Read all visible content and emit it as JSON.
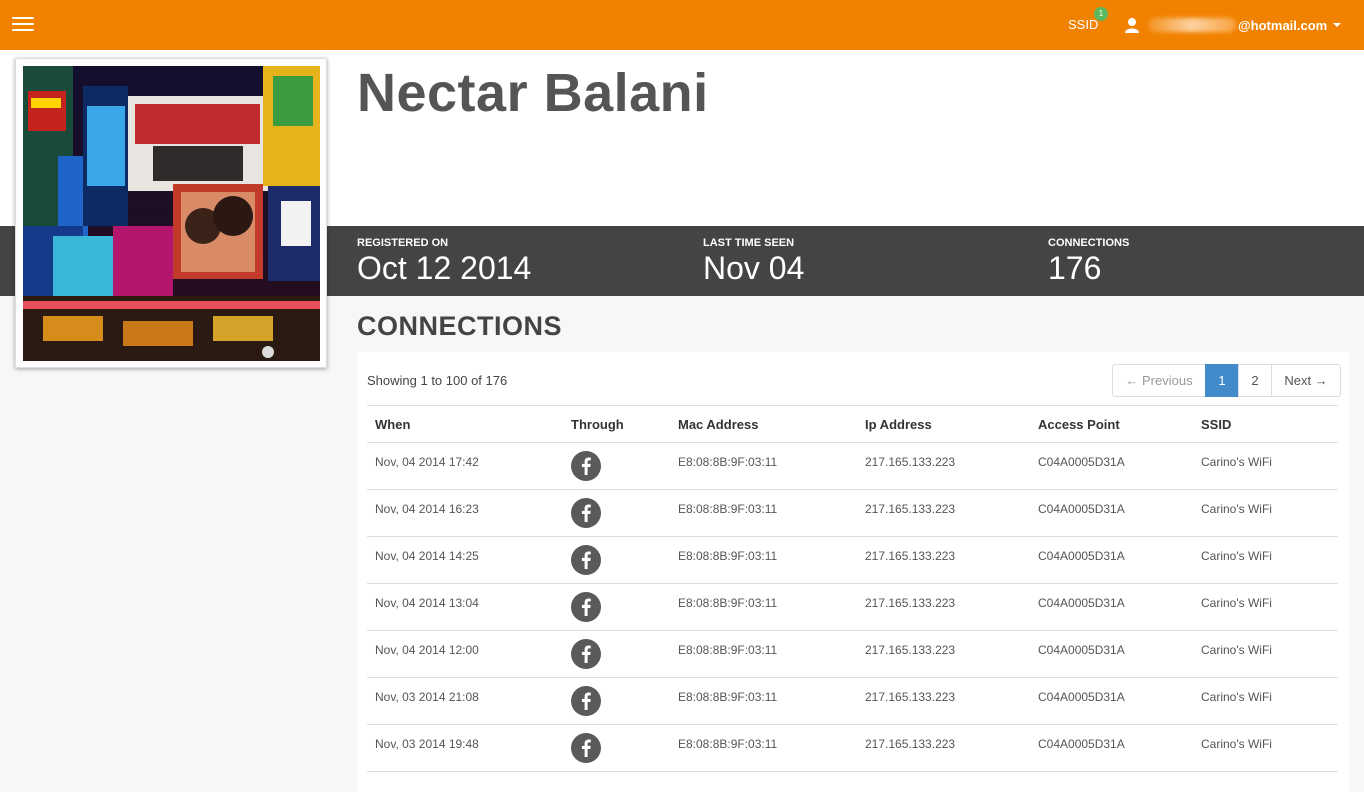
{
  "topbar": {
    "menu_icon": "hamburger-icon",
    "ssid_label": "SSID",
    "ssid_badge": "1",
    "user_icon": "user-icon",
    "user_email_suffix": "@hotmail.com",
    "brand_color": "#f18200"
  },
  "profile": {
    "name": "Nectar Balani",
    "photo_icon": "profile-photo"
  },
  "stats": {
    "registered_label": "REGISTERED ON",
    "registered_value": "Oct 12 2014",
    "last_seen_label": "LAST TIME SEEN",
    "last_seen_value": "Nov 04",
    "connections_label": "CONNECTIONS",
    "connections_value": "176"
  },
  "connections": {
    "title": "CONNECTIONS",
    "showing": "Showing 1 to 100 of 176",
    "pagination": {
      "previous": "← Previous",
      "pages": [
        "1",
        "2"
      ],
      "active_page": "1",
      "next": "Next →"
    },
    "columns": [
      "When",
      "Through",
      "Mac Address",
      "Ip Address",
      "Access Point",
      "SSID"
    ],
    "rows": [
      {
        "when": "Nov, 04 2014 17:42",
        "through": "facebook-icon",
        "mac": "E8:08:8B:9F:03:11",
        "ip": "217.165.133.223",
        "ap": "C04A0005D31A",
        "ssid": "Carino's WiFi"
      },
      {
        "when": "Nov, 04 2014 16:23",
        "through": "facebook-icon",
        "mac": "E8:08:8B:9F:03:11",
        "ip": "217.165.133.223",
        "ap": "C04A0005D31A",
        "ssid": "Carino's WiFi"
      },
      {
        "when": "Nov, 04 2014 14:25",
        "through": "facebook-icon",
        "mac": "E8:08:8B:9F:03:11",
        "ip": "217.165.133.223",
        "ap": "C04A0005D31A",
        "ssid": "Carino's WiFi"
      },
      {
        "when": "Nov, 04 2014 13:04",
        "through": "facebook-icon",
        "mac": "E8:08:8B:9F:03:11",
        "ip": "217.165.133.223",
        "ap": "C04A0005D31A",
        "ssid": "Carino's WiFi"
      },
      {
        "when": "Nov, 04 2014 12:00",
        "through": "facebook-icon",
        "mac": "E8:08:8B:9F:03:11",
        "ip": "217.165.133.223",
        "ap": "C04A0005D31A",
        "ssid": "Carino's WiFi"
      },
      {
        "when": "Nov, 03 2014 21:08",
        "through": "facebook-icon",
        "mac": "E8:08:8B:9F:03:11",
        "ip": "217.165.133.223",
        "ap": "C04A0005D31A",
        "ssid": "Carino's WiFi"
      },
      {
        "when": "Nov, 03 2014 19:48",
        "through": "facebook-icon",
        "mac": "E8:08:8B:9F:03:11",
        "ip": "217.165.133.223",
        "ap": "C04A0005D31A",
        "ssid": "Carino's WiFi"
      }
    ]
  }
}
